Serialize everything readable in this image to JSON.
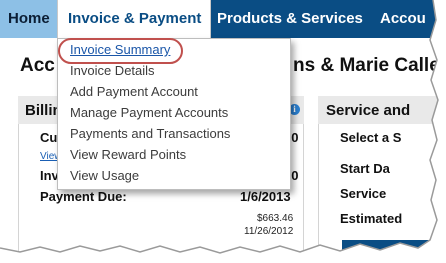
{
  "nav": {
    "home": "Home",
    "invoice_payment": "Invoice & Payment",
    "products_services": "Products & Services",
    "account": "Accou"
  },
  "dropdown": {
    "items": [
      "Invoice Summary",
      "Invoice Details",
      "Add Payment Account",
      "Manage Payment Accounts",
      "Payments and Transactions",
      "View Reward Points",
      "View Usage"
    ]
  },
  "page": {
    "account_title_left": "Acc",
    "account_title_right": "ns & Marie Calle",
    "billing": {
      "title": "Billin",
      "row1_label": "Cu",
      "row1_value": "20",
      "view_link": "View",
      "row2_label": "Inv",
      "row2_value": "20",
      "payment_due_label": "Payment Due:",
      "payment_due_value": "1/6/2013",
      "amount": "$663.46",
      "amount_date": "11/26/2012"
    },
    "service": {
      "title": "Service and",
      "select": "Select a S",
      "start_date": "Start Da",
      "service": "Service",
      "estimated": "Estimated"
    }
  }
}
